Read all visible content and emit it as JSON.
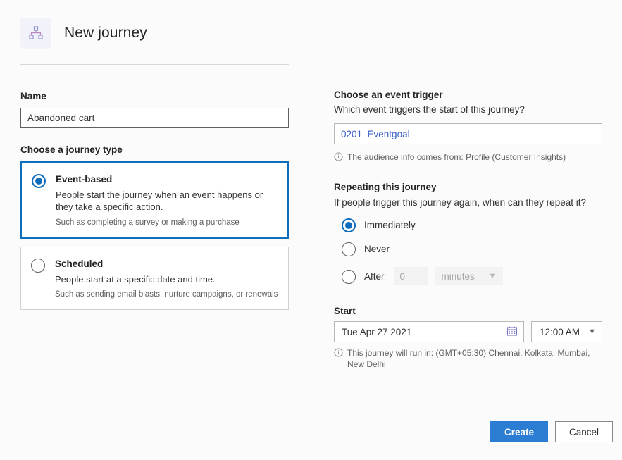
{
  "header": {
    "icon": "hierarchy-icon",
    "title": "New journey"
  },
  "left": {
    "name_label": "Name",
    "name_value": "Abandoned cart",
    "journey_type_label": "Choose a journey type",
    "options": [
      {
        "title": "Event-based",
        "description": "People start the journey when an event happens or they take a specific action.",
        "hint": "Such as completing a survey or making a purchase",
        "selected": true
      },
      {
        "title": "Scheduled",
        "description": "People start at a specific date and time.",
        "hint": "Such as sending email blasts, nurture campaigns, or renewals",
        "selected": false
      }
    ]
  },
  "right": {
    "trigger": {
      "heading": "Choose an event trigger",
      "subheading": "Which event triggers the start of this journey?",
      "value": "0201_Eventgoal",
      "note_icon": "info-icon",
      "note": "The audience info comes from: Profile (Customer Insights)"
    },
    "repeat": {
      "heading": "Repeating this journey",
      "subheading": "If people trigger this journey again, when can they repeat it?",
      "options": [
        {
          "label": "Immediately",
          "selected": true
        },
        {
          "label": "Never",
          "selected": false
        },
        {
          "label": "After",
          "selected": false
        }
      ],
      "after_number_value": "0",
      "after_unit_value": "minutes",
      "unit_chevron": "chevron-down-icon"
    },
    "start": {
      "heading": "Start",
      "date_value": "Tue Apr 27 2021",
      "calendar_icon": "calendar-icon",
      "time_value": "12:00 AM",
      "time_chevron": "chevron-down-icon",
      "note_icon": "info-icon",
      "note": "This journey will run in: (GMT+05:30) Chennai, Kolkata, Mumbai, New Delhi"
    }
  },
  "footer": {
    "create_label": "Create",
    "cancel_label": "Cancel"
  },
  "colors": {
    "accent_blue": "#0f6cbd",
    "primary_button": "#2b7cd3",
    "trigger_text": "#3b5fc9",
    "icon_purple": "#8a8ad0",
    "page_background": "#fbfbfb"
  }
}
